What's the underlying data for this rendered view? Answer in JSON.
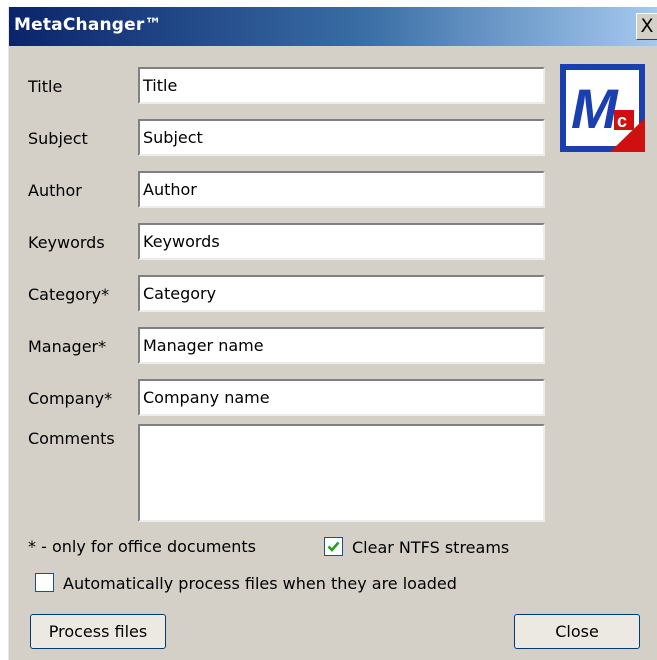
{
  "window": {
    "title": "MetaChanger™",
    "close_label": "X"
  },
  "fields": [
    {
      "label": "Title",
      "value": "Title"
    },
    {
      "label": "Subject",
      "value": "Subject"
    },
    {
      "label": "Author",
      "value": "Author"
    },
    {
      "label": "Keywords",
      "value": "Keywords"
    },
    {
      "label": "Category*",
      "value": "Category"
    },
    {
      "label": "Manager*",
      "value": "Manager name"
    },
    {
      "label": "Company*",
      "value": "Company name"
    },
    {
      "label": "Comments",
      "value": ""
    }
  ],
  "logo": {
    "icon": "metachanger-logo-icon",
    "letter": "M",
    "sub": "c"
  },
  "note": "* - only for office documents",
  "options": {
    "clear_ntfs": {
      "label": "Clear NTFS streams",
      "checked": true
    },
    "auto_process": {
      "label": "Automatically process files when they are loaded",
      "checked": false
    }
  },
  "buttons": {
    "process": "Process files",
    "close": "Close"
  },
  "colors": {
    "titlebar_start": "#0a246a",
    "titlebar_end": "#a6caf0",
    "logo_blue": "#1a3fb0",
    "logo_red": "#d01010"
  }
}
